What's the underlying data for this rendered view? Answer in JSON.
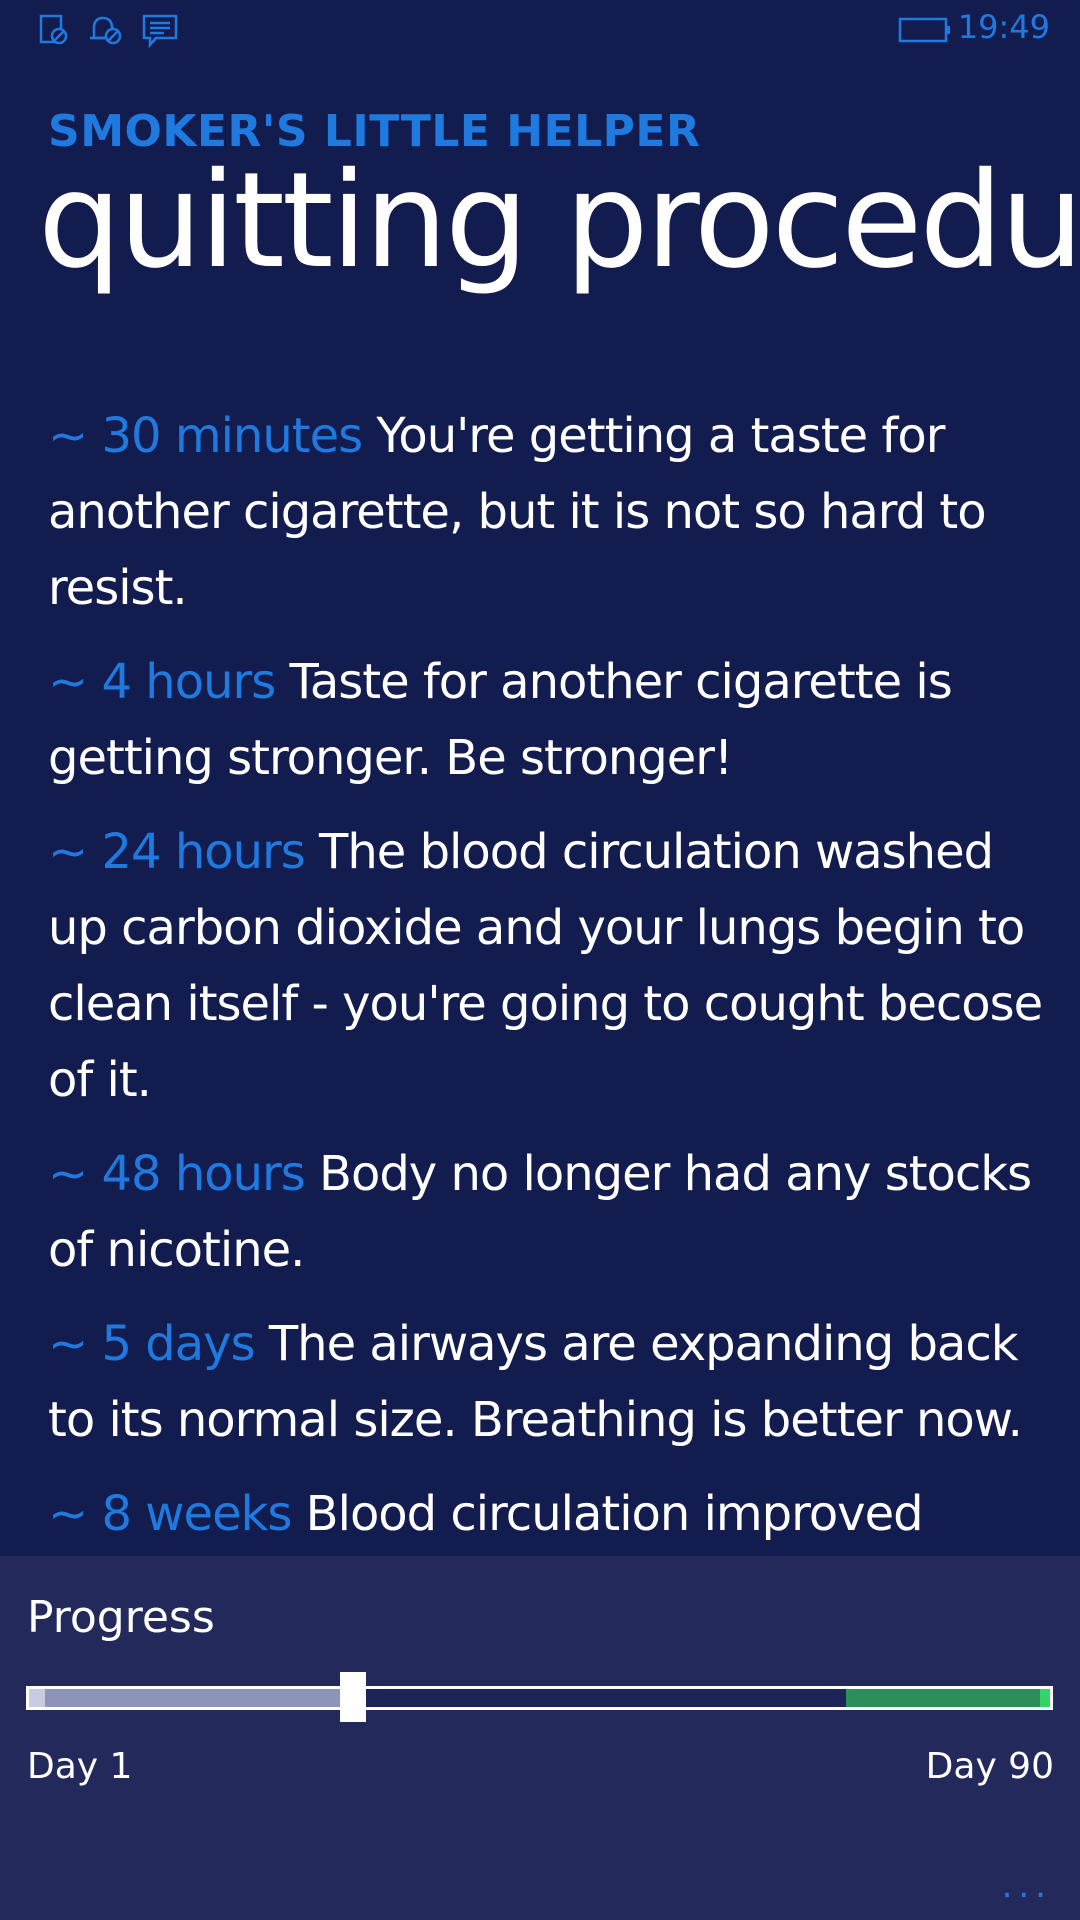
{
  "status_bar": {
    "time": "19:49",
    "icons": [
      "alarm-off-icon",
      "quiet-hours-icon",
      "message-icon",
      "battery-icon"
    ],
    "accent_color": "#1f7ae0"
  },
  "header": {
    "app_title": "SMOKER'S LITTLE HELPER",
    "page_title": "quitting procedure"
  },
  "timeline": [
    {
      "time": "~ 30 minutes",
      "text": "You're getting a taste for another cigarette, but it is not so hard to resist."
    },
    {
      "time": "~ 4 hours",
      "text": "Taste for another cigarette is getting stronger. Be stronger!"
    },
    {
      "time": "~ 24 hours",
      "text": "The blood circulation washed up carbon dioxide and your lungs begin to clean itself - you're going to cought becose of it."
    },
    {
      "time": "~ 48 hours",
      "text": "Body no longer had any stocks of nicotine."
    },
    {
      "time": "~ 5 days",
      "text": "The airways are expanding back to its normal size. Breathing is better now."
    },
    {
      "time": "~ 8 weeks",
      "text": "Blood circulation improved"
    }
  ],
  "progress": {
    "label": "Progress",
    "start_label": "Day 1",
    "end_label": "Day 90",
    "current_fraction": 0.32,
    "filled_fraction": 0.325,
    "goal_zone_fraction": 0.2,
    "colors": {
      "fill": "#8e93ba",
      "goal_zone": "#2a8f5a",
      "goal_end": "#35d36a",
      "panel": "#232a5b"
    }
  },
  "app_bar": {
    "more_label": "..."
  }
}
